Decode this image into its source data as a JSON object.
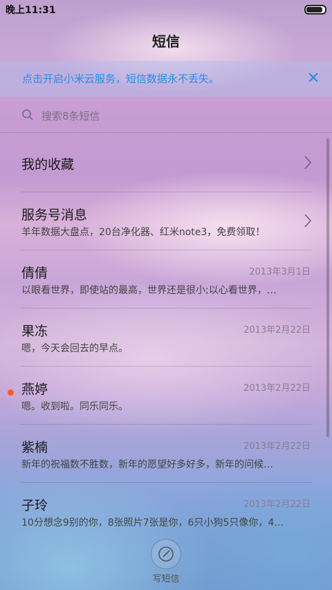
{
  "status_bar": {
    "time": "晚上11:31",
    "battery_level": 0.9
  },
  "header": {
    "title": "短信"
  },
  "banner": {
    "text": "点击开启小米云服务，短信数据永不丢失。",
    "close_icon": "close-icon"
  },
  "search": {
    "placeholder": "搜索8条短信"
  },
  "special_items": [
    {
      "label": "我的收藏"
    },
    {
      "label": "服务号消息",
      "snippet": "羊年数据大盘点，20台净化器、红米note3，免费领取！"
    }
  ],
  "conversations": [
    {
      "name": "倩倩",
      "date": "2013年3月1日",
      "snippet": "以眼看世界，即使站的最高，世界还是很小;以心看世界，…",
      "unread": false
    },
    {
      "name": "果冻",
      "date": "2013年2月22日",
      "snippet": "嗯，今天会回去的早点。",
      "unread": false
    },
    {
      "name": "燕婷",
      "date": "2013年2月22日",
      "snippet": "嗯。收到啦。同乐同乐。",
      "unread": true
    },
    {
      "name": "紫楠",
      "date": "2013年2月22日",
      "snippet": "新年的祝福数不胜数，新年的愿望好多好多，新年的问候…",
      "unread": false
    },
    {
      "name": "子玲",
      "date": "2013年2月22日",
      "snippet": "10分想念9别的你，8张照片7张是你，6只小狗5只像你，4…",
      "unread": false
    }
  ],
  "compose": {
    "label": "写短信",
    "icon": "compose-icon"
  },
  "colors": {
    "accent": "#2a8de8",
    "unread_dot": "#ff5a1f"
  }
}
